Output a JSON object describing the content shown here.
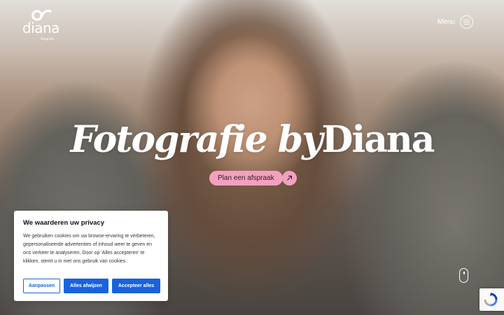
{
  "brand": {
    "logo_text": "diana",
    "logo_subtext": "fotografie",
    "accent_color": "#f4a0bf"
  },
  "header": {
    "menu_label": "Menu",
    "menu_icon": "hamburger-icon"
  },
  "hero": {
    "title_italic": "Fotografie",
    "title_by": "by",
    "title_name": "Diana",
    "cta_label": "Plan een afspraak",
    "cta_icon": "arrow-up-right-icon",
    "scroll_icon": "scroll-mouse-icon"
  },
  "cookie": {
    "title": "We waarderen uw privacy",
    "text": "We gebruiken cookies om uw browse-ervaring te verbeteren, gepersonaliseerde advertenties of inhoud weer te geven en ons verkeer te analyseren. Door op 'Alles accepteren' te klikken, stemt u in met ons gebruik van cookies.",
    "customize_label": "Aanpassen",
    "reject_label": "Alles afwijzen",
    "accept_label": "Accepteer alles",
    "button_color": "#1863dc"
  },
  "recaptcha": {
    "icon": "recaptcha-icon"
  }
}
